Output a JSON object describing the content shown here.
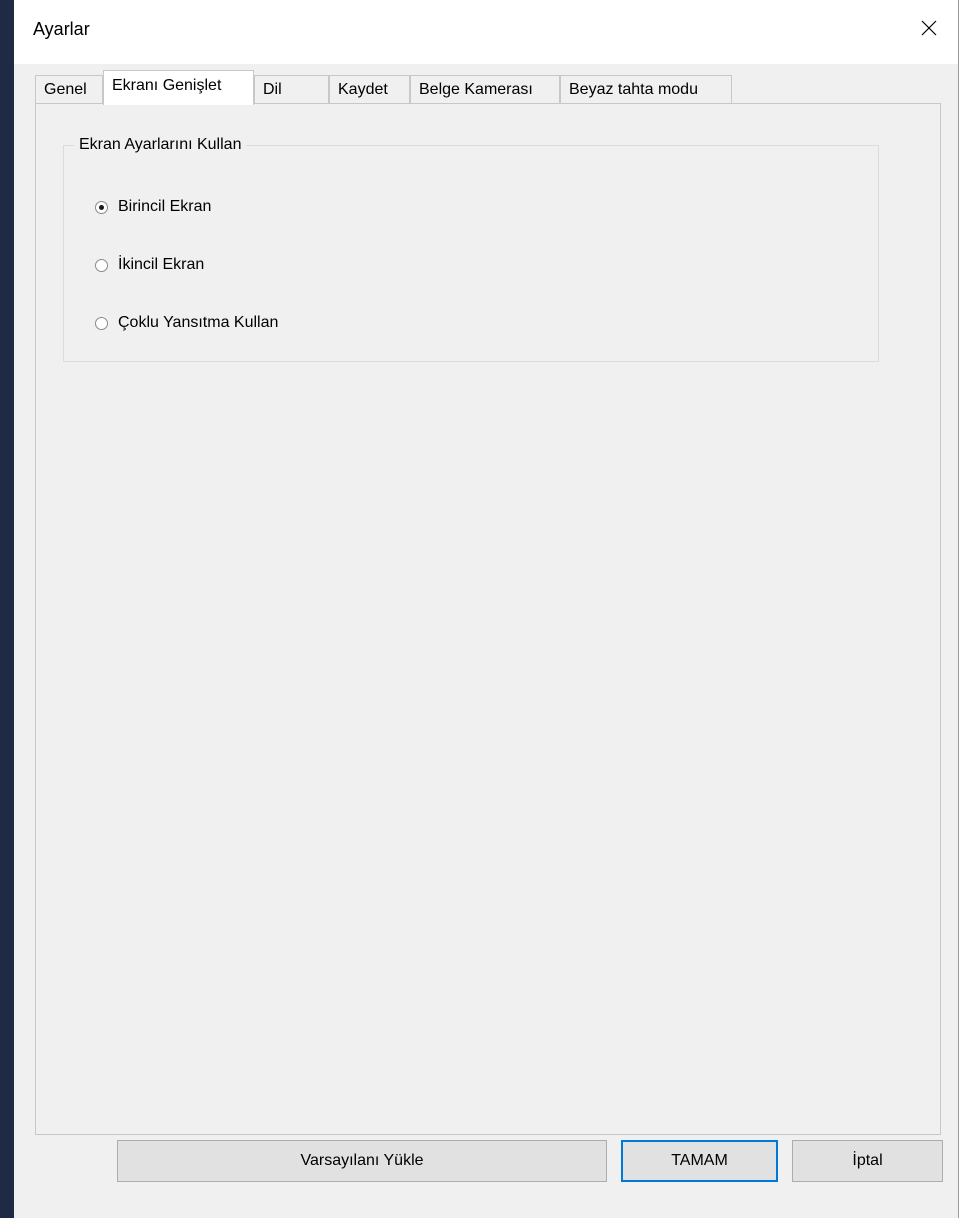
{
  "window": {
    "title": "Ayarlar",
    "close_icon": "close-icon"
  },
  "tabs": [
    {
      "label": "Genel",
      "active": false
    },
    {
      "label": "Ekranı Genişlet",
      "active": true
    },
    {
      "label": "Dil",
      "active": false
    },
    {
      "label": "Kaydet",
      "active": false
    },
    {
      "label": "Belge Kamerası",
      "active": false
    },
    {
      "label": "Beyaz tahta modu",
      "active": false
    }
  ],
  "group": {
    "legend": "Ekran Ayarlarını Kullan",
    "options": [
      {
        "label": "Birincil Ekran",
        "checked": true
      },
      {
        "label": "İkincil Ekran",
        "checked": false
      },
      {
        "label": "Çoklu Yansıtma Kullan",
        "checked": false
      }
    ]
  },
  "buttons": {
    "load_defaults": "Varsayılanı Yükle",
    "ok": "TAMAM",
    "cancel": "İptal"
  },
  "colors": {
    "default_button_border": "#0078d7",
    "window_background": "#f0f0f0"
  }
}
